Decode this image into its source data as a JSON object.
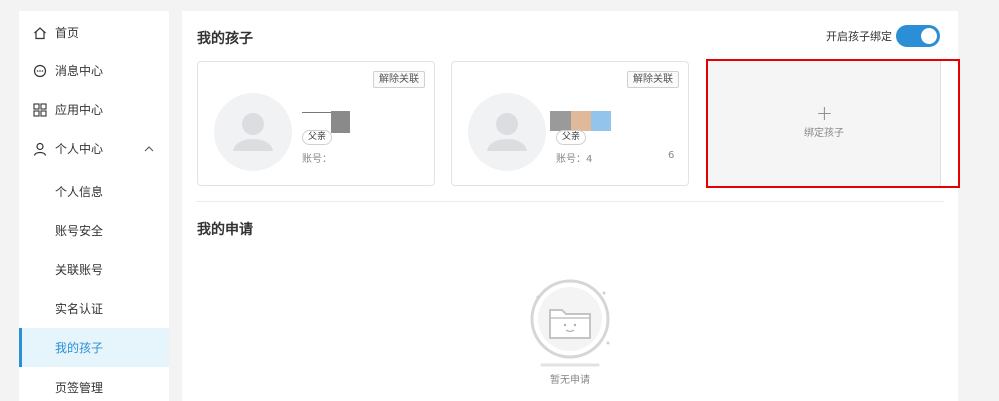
{
  "sidebar": {
    "items": [
      {
        "label": "首页",
        "icon": "home-icon"
      },
      {
        "label": "消息中心",
        "icon": "message-icon"
      },
      {
        "label": "应用中心",
        "icon": "apps-icon"
      },
      {
        "label": "个人中心",
        "icon": "user-icon"
      }
    ],
    "sub_items": [
      {
        "label": "个人信息"
      },
      {
        "label": "账号安全"
      },
      {
        "label": "关联账号"
      },
      {
        "label": "实名认证"
      },
      {
        "label": "我的孩子",
        "active": true
      },
      {
        "label": "页签管理"
      }
    ]
  },
  "main": {
    "children_title": "我的孩子",
    "toggle_label": "开启孩子绑定",
    "toggle_on": true,
    "children": [
      {
        "name": "",
        "relation": "父亲",
        "account": "账号：",
        "unbind_label": "解除关联"
      },
      {
        "name": "",
        "relation": "父亲",
        "account": "账号：4",
        "account_suffix": "6",
        "unbind_label": "解除关联"
      }
    ],
    "add_card": {
      "plus": "+",
      "label": "绑定孩子"
    },
    "applications_title": "我的申请",
    "empty_text": "暂无申请"
  },
  "colors": {
    "accent": "#2b8fd6",
    "highlight_border": "#e60000",
    "active_bg": "#e6f4fc"
  }
}
